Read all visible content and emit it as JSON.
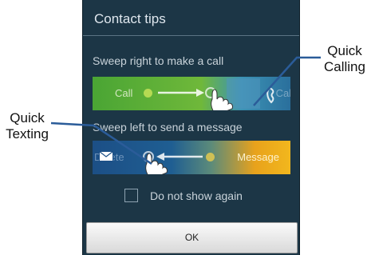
{
  "dialog": {
    "title": "Contact tips",
    "call_tip": "Sweep right to make a call",
    "message_tip": "Sweep left to send a message",
    "call_strip": {
      "label": "Call",
      "ghost_label": "Call"
    },
    "message_strip": {
      "label": "Message",
      "ghost_label": "Delete"
    },
    "checkbox": {
      "label": "Do not show again",
      "checked": false
    },
    "ok_button": "OK"
  },
  "callouts": {
    "quick_calling": {
      "line1": "Quick",
      "line2": "Calling"
    },
    "quick_texting": {
      "line1": "Quick",
      "line2": "Texting"
    }
  },
  "icons": {
    "call_strip": [
      "green-dot",
      "right-arrow",
      "hand-icon",
      "phone-icon"
    ],
    "message_strip": [
      "envelope-icon",
      "hand-icon",
      "left-arrow",
      "yellow-dot"
    ]
  },
  "colors": {
    "dialog_bg": "#1c3646",
    "callout_line": "#2b5c99",
    "call_green": "#4aa534",
    "message_orange": "#f2b71d"
  }
}
